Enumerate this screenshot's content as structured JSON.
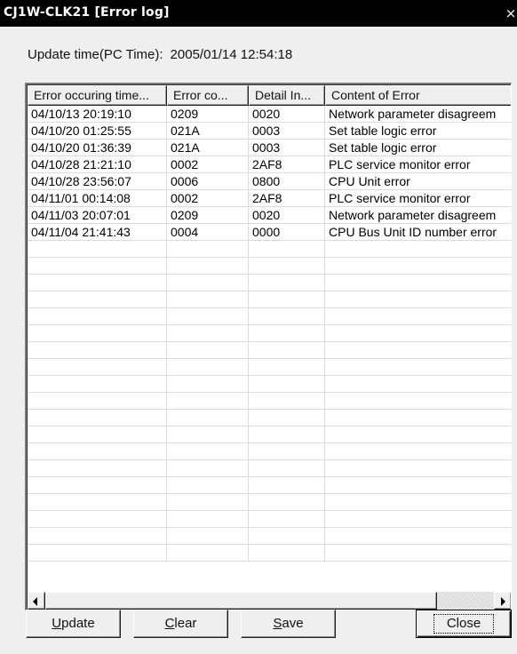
{
  "window": {
    "title": "CJ1W-CLK21 [Error log]",
    "close_glyph": "×"
  },
  "update": {
    "label": "Update time(PC Time):",
    "value": "2005/01/14 12:54:18"
  },
  "table": {
    "columns": [
      "Error occuring time...",
      "Error co...",
      "Detail In...",
      "Content of Error"
    ],
    "rows": [
      [
        "04/10/13 20:19:10",
        "0209",
        "0020",
        "Network parameter disagreem"
      ],
      [
        "04/10/20 01:25:55",
        "021A",
        "0003",
        "Set table logic error"
      ],
      [
        "04/10/20 01:36:39",
        "021A",
        "0003",
        "Set table logic error"
      ],
      [
        "04/10/28 21:21:10",
        "0002",
        "2AF8",
        "PLC service monitor error"
      ],
      [
        "04/10/28 23:56:07",
        "0006",
        "0800",
        "CPU Unit error"
      ],
      [
        "04/11/01 00:14:08",
        "0002",
        "2AF8",
        "PLC service monitor error"
      ],
      [
        "04/11/03 20:07:01",
        "0209",
        "0020",
        "Network parameter disagreem"
      ],
      [
        "04/11/04 21:41:43",
        "0004",
        "0000",
        "CPU Bus Unit ID number error"
      ]
    ]
  },
  "buttons": {
    "update": {
      "mnemonic": "U",
      "rest": "pdate"
    },
    "clear": {
      "mnemonic": "C",
      "rest": "lear"
    },
    "save": {
      "mnemonic": "S",
      "rest": "ave"
    },
    "close": "Close"
  },
  "icons": {
    "scroll_left": "left-arrow-icon",
    "scroll_right": "right-arrow-icon"
  }
}
